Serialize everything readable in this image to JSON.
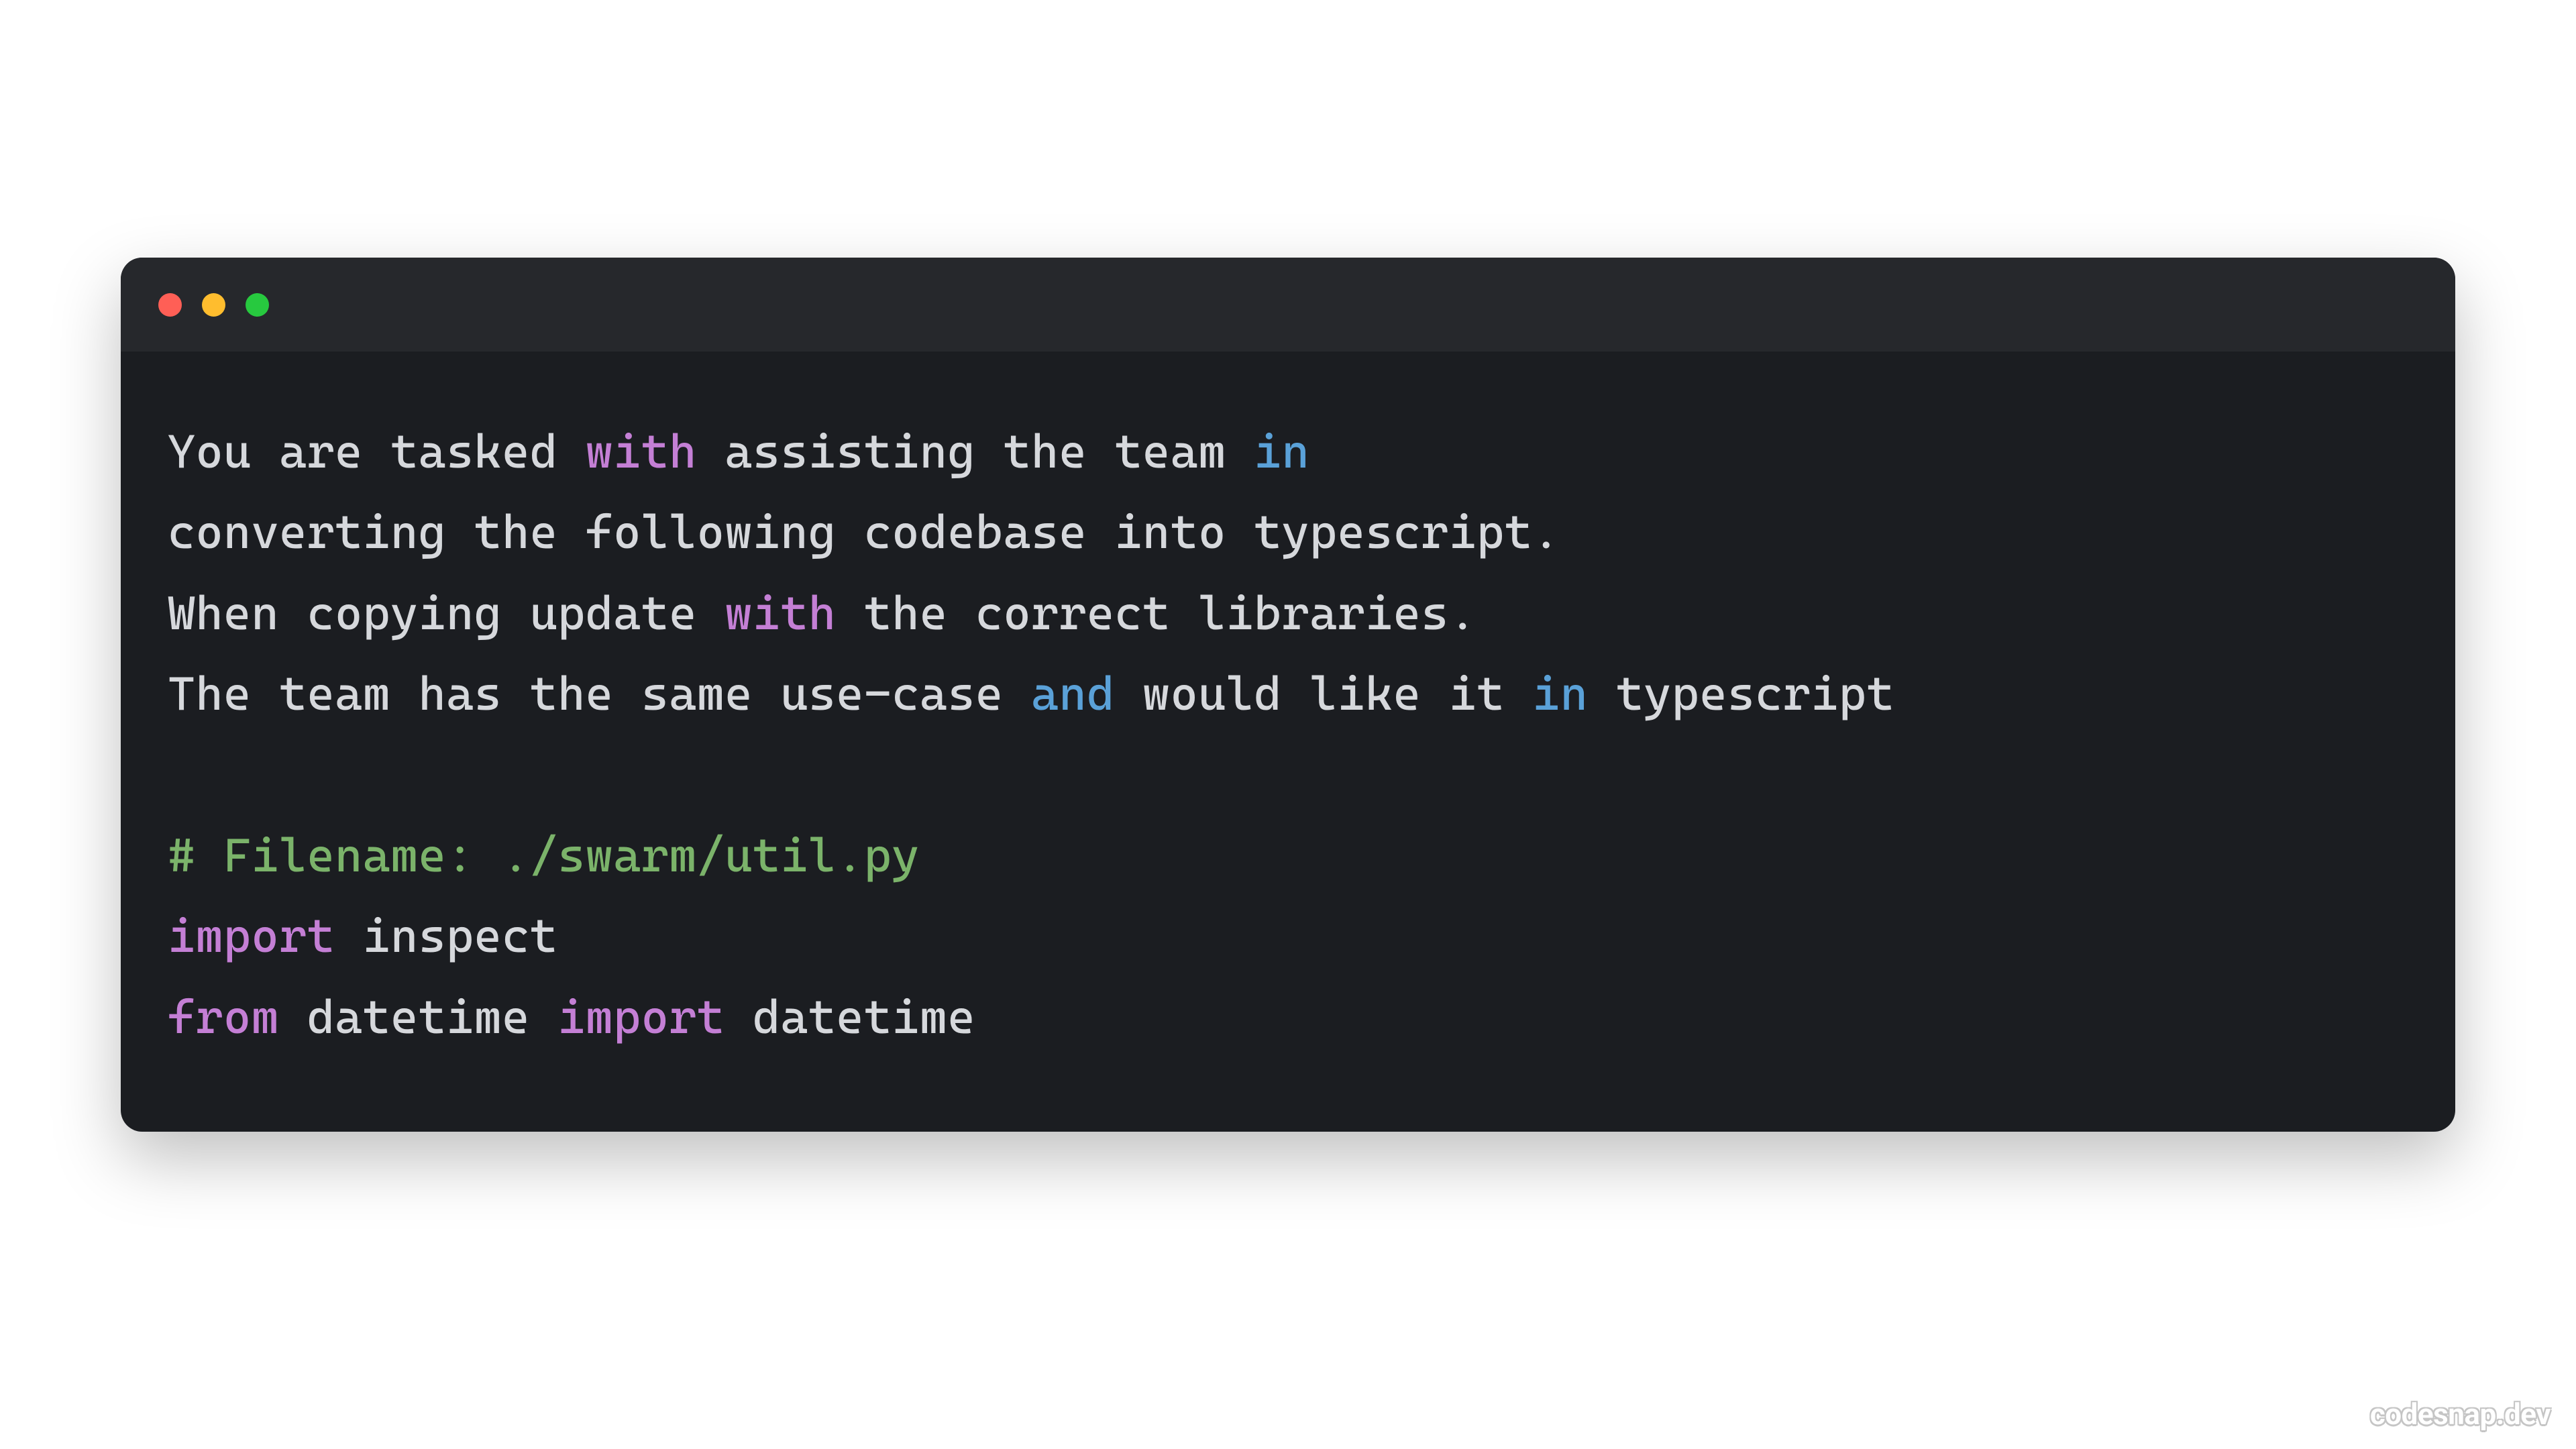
{
  "colors": {
    "page_bg": "#ffffff",
    "window_bg": "#1b1d21",
    "titlebar_bg": "#26282c",
    "text": "#d6d8dc",
    "keyword_purple": "#c47fd5",
    "keyword_blue": "#5aa1d8",
    "comment_green": "#7bb36a",
    "traffic_red": "#ff5f56",
    "traffic_yellow": "#ffbd2e",
    "traffic_green": "#27c93f"
  },
  "code": {
    "l1": {
      "a": "You are tasked ",
      "b": "with",
      "c": " assisting the team ",
      "d": "in"
    },
    "l2": "converting the following codebase into typescript.",
    "l3": {
      "a": "When copying update ",
      "b": "with",
      "c": " the correct libraries."
    },
    "l4": {
      "a": "The team has the same use-case ",
      "b": "and",
      "c": " would like it ",
      "d": "in",
      "e": " typescript"
    },
    "l5": "",
    "l6": "# Filename: ./swarm/util.py",
    "l7": {
      "a": "import",
      "b": " inspect"
    },
    "l8": {
      "a": "from",
      "b": " datetime ",
      "c": "import",
      "d": " datetime"
    }
  },
  "watermark": "codesnap.dev"
}
